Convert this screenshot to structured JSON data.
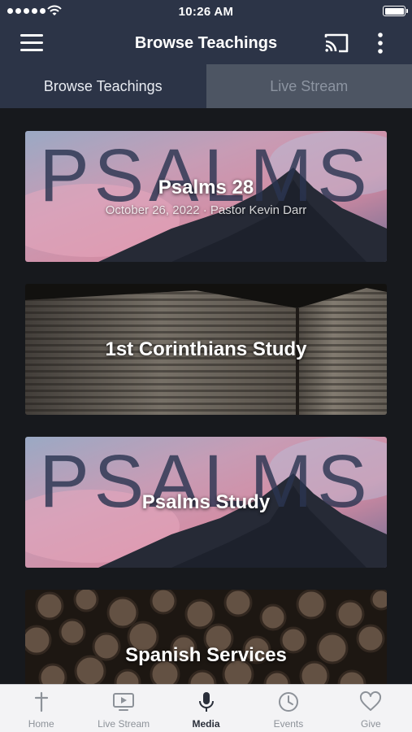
{
  "status_bar": {
    "time": "10:26 AM"
  },
  "nav": {
    "title": "Browse Teachings",
    "menu_icon": "hamburger-menu-icon",
    "cast_icon": "cast-icon",
    "more_icon": "more-vertical-icon"
  },
  "tabs": [
    {
      "label": "Browse Teachings",
      "active": true
    },
    {
      "label": "Live Stream",
      "active": false
    }
  ],
  "cards": [
    {
      "title": "Psalms 28",
      "subtitle": "October 26, 2022 · Pastor Kevin Darr",
      "art_text": "PSALMS"
    },
    {
      "title": "1st Corinthians Study",
      "subtitle": ""
    },
    {
      "title": "Psalms Study",
      "subtitle": "",
      "art_text": "PSALMS"
    },
    {
      "title": "Spanish Services",
      "subtitle": ""
    }
  ],
  "tab_bar": [
    {
      "label": "Home",
      "icon": "cross-icon",
      "active": false
    },
    {
      "label": "Live Stream",
      "icon": "tv-play-icon",
      "active": false
    },
    {
      "label": "Media",
      "icon": "microphone-icon",
      "active": true
    },
    {
      "label": "Events",
      "icon": "clock-icon",
      "active": false
    },
    {
      "label": "Give",
      "icon": "heart-icon",
      "active": false
    }
  ],
  "colors": {
    "header": "#2c3447",
    "tab_inactive": "#4d5563",
    "background": "#17191d",
    "tabbar_bg": "#f3f3f5",
    "tabbar_active": "#2a2f3a",
    "tabbar_inactive": "#8d9299"
  }
}
